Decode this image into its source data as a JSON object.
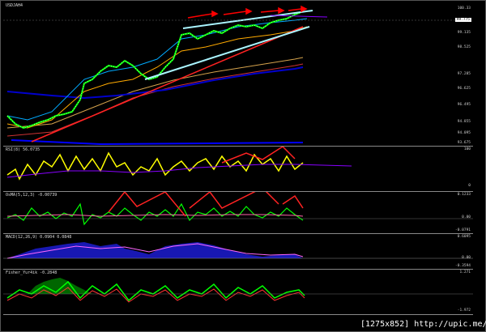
{
  "panes": [
    {
      "key": "main",
      "title": "USDJAH4",
      "labels": [
        "100.33",
        "99.775",
        "99.135",
        "98.525",
        "97.285",
        "96.625",
        "96.495",
        "94.855",
        "94.095",
        "93.675"
      ],
      "current": "99.775"
    },
    {
      "key": "rsi",
      "title": "RSI(8) 56.0735",
      "labels": [
        "100",
        "0"
      ]
    },
    {
      "key": "osma",
      "title": "OsMA(5,12,3) -0.00739",
      "labels": [
        "0.1233",
        "0.00",
        "-0.0791"
      ]
    },
    {
      "key": "macd",
      "title": "MACD(12,26,9) 0.0904 0.0848",
      "labels": [
        "0.6095",
        "0.00",
        "-0.3594"
      ]
    },
    {
      "key": "fisher",
      "title": "Fisher_Yur4ik -0.2848",
      "labels": [
        "1.271",
        "-1.972"
      ]
    }
  ],
  "footer": "[1275x852] http://upic.me/",
  "colors": {
    "bg": "#000000",
    "up": "#00ff00",
    "down": "#ffffff",
    "red": "#ff0000",
    "cyan": "#aaf5ff",
    "blue": "#0000ff",
    "yellow": "#ffff00",
    "purple": "#8800ff"
  }
}
